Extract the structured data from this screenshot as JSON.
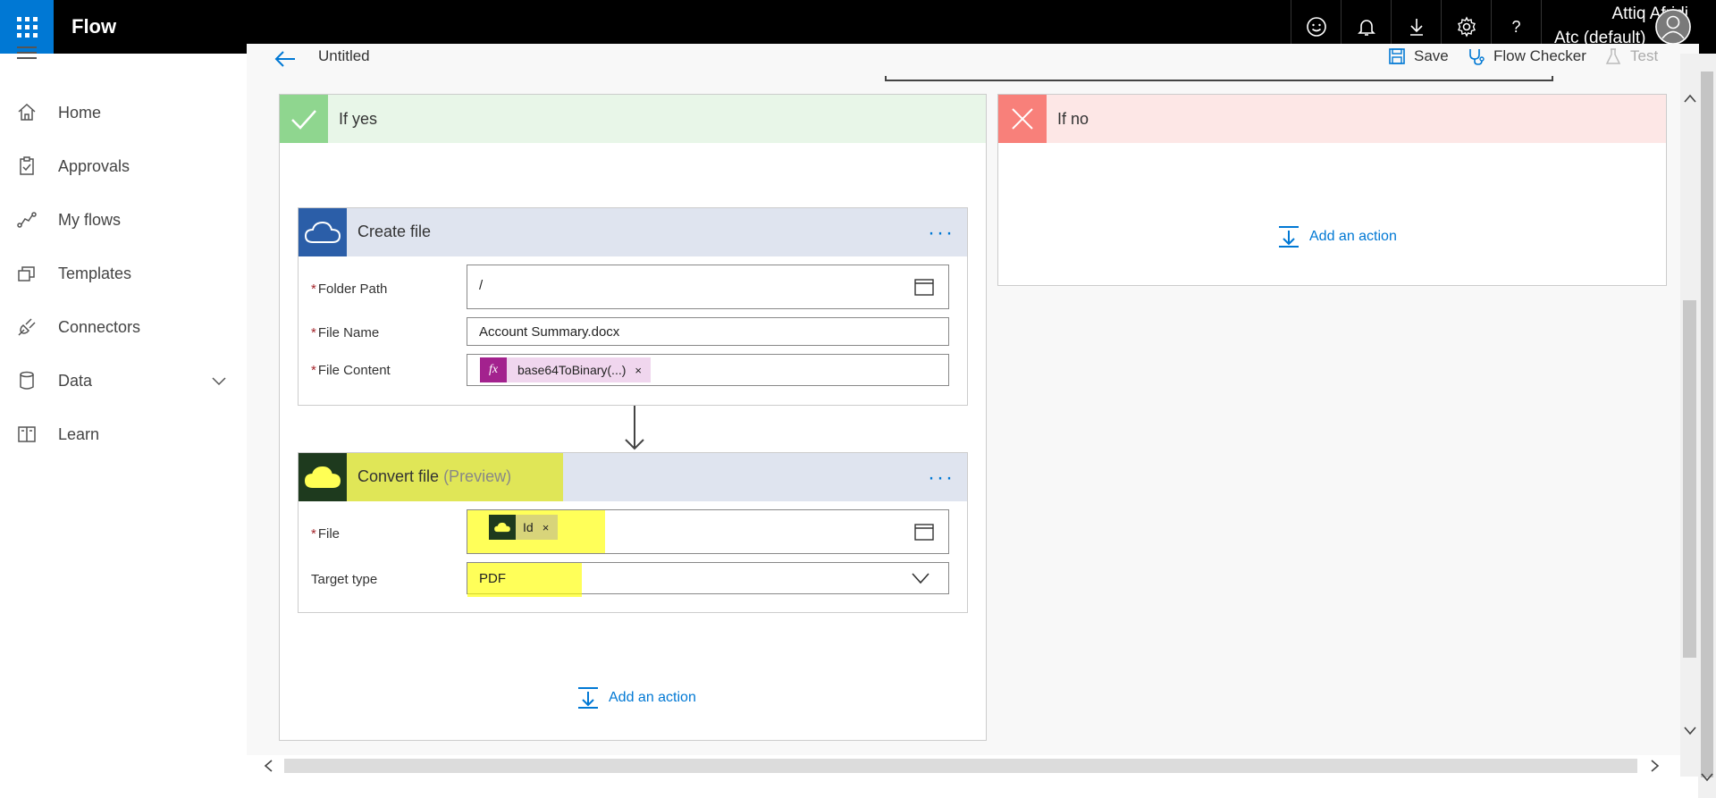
{
  "topbar": {
    "app_name": "Flow",
    "user_name": "Attiq Afridi",
    "user_env": "Atc (default)",
    "icons": [
      "smiley-icon",
      "bell-icon",
      "download-icon",
      "gear-icon",
      "help-icon"
    ],
    "help_glyph": "?"
  },
  "sidebar": {
    "items": [
      {
        "label": "Home",
        "icon": "home-icon"
      },
      {
        "label": "Approvals",
        "icon": "clipboard-icon"
      },
      {
        "label": "My flows",
        "icon": "flow-icon"
      },
      {
        "label": "Templates",
        "icon": "templates-icon"
      },
      {
        "label": "Connectors",
        "icon": "plug-icon"
      },
      {
        "label": "Data",
        "icon": "database-icon"
      },
      {
        "label": "Learn",
        "icon": "book-icon"
      }
    ]
  },
  "cmdbar": {
    "title": "Untitled",
    "save": "Save",
    "flow_checker": "Flow Checker",
    "test": "Test"
  },
  "branches": {
    "yes": {
      "title": "If yes",
      "color": "#a6e3a6"
    },
    "no": {
      "title": "If no",
      "color": "#f8807a"
    }
  },
  "create_file": {
    "title": "Create file",
    "folder_path_label": "Folder Path",
    "folder_path_value": "/",
    "file_name_label": "File Name",
    "file_name_value": "Account Summary.docx",
    "file_content_label": "File Content",
    "file_content_token": "base64ToBinary(...)",
    "token_x": "×",
    "fx_glyph": "fx"
  },
  "convert_file": {
    "title": "Convert file",
    "preview": "(Preview)",
    "file_label": "File",
    "file_token": "Id",
    "token_x": "×",
    "target_type_label": "Target type",
    "target_type_value": "PDF"
  },
  "required_mark": "*",
  "add_action": "Add an action",
  "colors": {
    "accent": "#0078d4",
    "onedrive_blue": "#2b5ea8",
    "onedrive_dark": "#1e4a1e",
    "highlight": "#ffff00"
  }
}
